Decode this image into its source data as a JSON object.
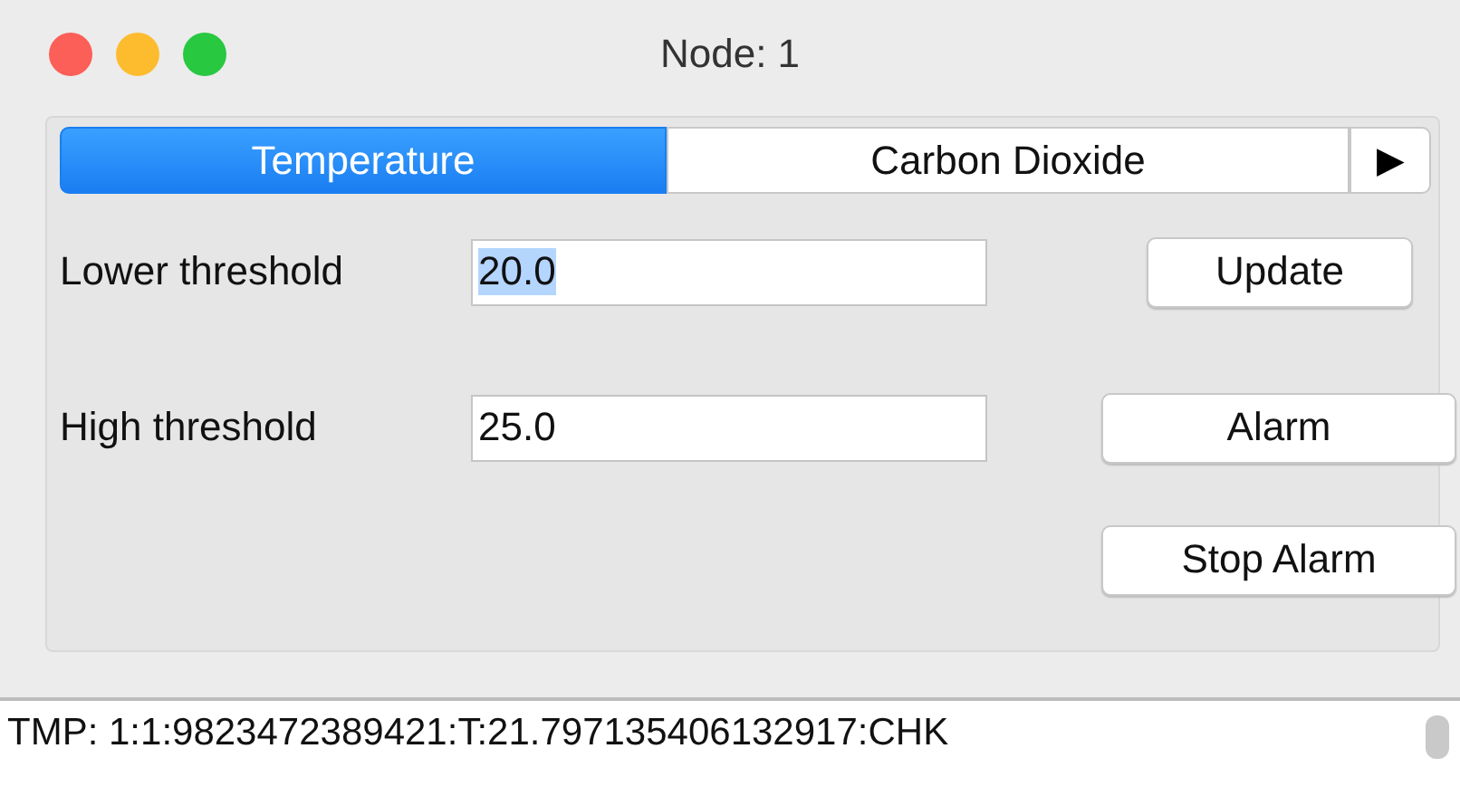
{
  "window": {
    "title": "Node: 1"
  },
  "tabs": [
    {
      "label": "Temperature",
      "selected": true
    },
    {
      "label": "Carbon Dioxide",
      "selected": false
    }
  ],
  "tab_scroll": "▶",
  "fields": [
    {
      "label": "Lower threshold",
      "value": "20.0",
      "text_selected": true
    },
    {
      "label": "High threshold",
      "value": "25.0",
      "text_selected": false
    }
  ],
  "buttons": [
    "Update",
    "Alarm",
    "Stop Alarm"
  ],
  "log": [
    "TMP: 1:1:9823472389421:T:21.797135406132917:CHK"
  ]
}
